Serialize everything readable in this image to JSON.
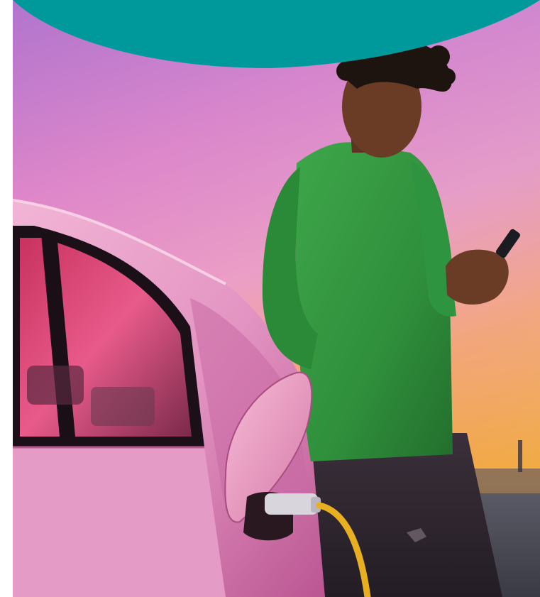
{
  "colors": {
    "accent_teal": "#00999b",
    "sky_top": "#a34fc4",
    "sky_mid": "#e979c6",
    "sky_horizon": "#f7a84a",
    "sweater": "#2e8b3a",
    "car_body": "#e8a0c8",
    "charging_cable": "#e8b020"
  },
  "photo": {
    "subject": "person-with-phone-charging-electric-car"
  }
}
